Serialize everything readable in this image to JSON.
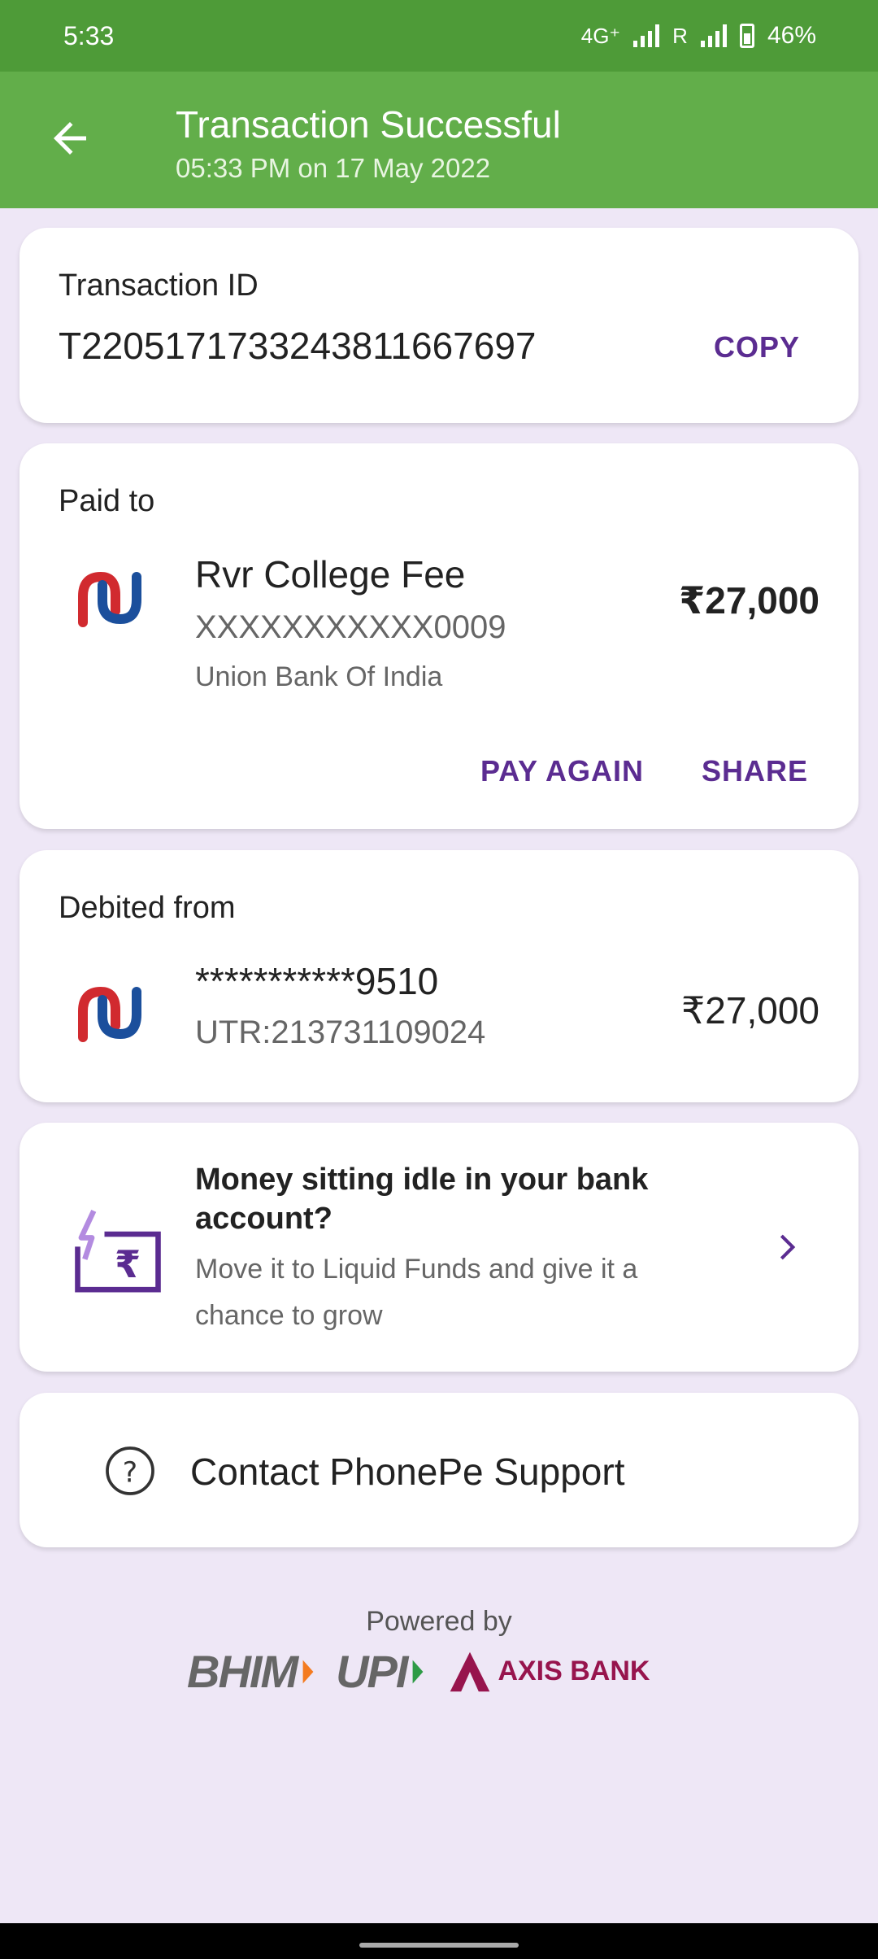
{
  "status": {
    "time": "5:33",
    "network": "4G⁺",
    "roaming": "R",
    "battery": "46%"
  },
  "header": {
    "title": "Transaction Successful",
    "subtitle": "05:33 PM on 17 May 2022"
  },
  "transaction": {
    "label": "Transaction ID",
    "id": "T2205171733243811667697",
    "copy_label": "COPY"
  },
  "paid_to": {
    "label": "Paid to",
    "name": "Rvr College Fee",
    "account": "XXXXXXXXXXX0009",
    "bank": "Union Bank Of India",
    "amount": "₹27,000",
    "pay_again_label": "PAY AGAIN",
    "share_label": "SHARE"
  },
  "debited_from": {
    "label": "Debited from",
    "account": "***********9510",
    "utr": "UTR:213731109024",
    "amount": "₹27,000"
  },
  "promo": {
    "title": "Money sitting idle in your bank account?",
    "text": "Move it to Liquid Funds and give it a chance to grow"
  },
  "support": {
    "label": "Contact PhonePe Support"
  },
  "footer": {
    "powered_by": "Powered by",
    "bhim": "BHIM",
    "upi": "UPI",
    "axis": "AXIS BANK"
  },
  "colors": {
    "header_green": "#62AE4A",
    "status_green": "#4E9B38",
    "accent_purple": "#5B2C91",
    "background": "#EEE7F6"
  }
}
